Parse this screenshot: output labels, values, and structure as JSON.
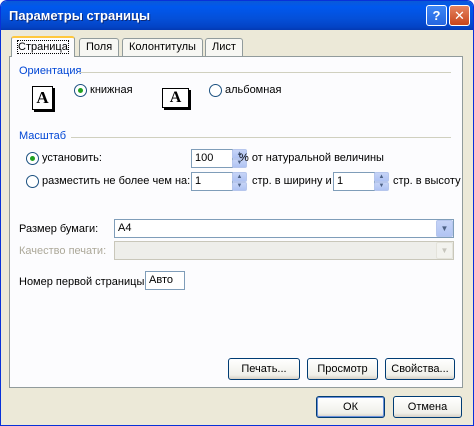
{
  "window": {
    "title": "Параметры страницы",
    "help_glyph": "?",
    "close_glyph": "✕"
  },
  "tabs": [
    {
      "label": "Страница",
      "active": true
    },
    {
      "label": "Поля"
    },
    {
      "label": "Колонтитулы"
    },
    {
      "label": "Лист"
    }
  ],
  "orientation": {
    "label": "Ориентация",
    "portrait_label": "книжная",
    "landscape_label": "альбомная",
    "icon_letter": "A",
    "selected": "portrait"
  },
  "scale": {
    "label": "Масштаб",
    "set_label": "установить:",
    "set_value": "100",
    "set_suffix": "% от натуральной величины",
    "fit_label": "разместить не более чем на:",
    "fit_width_value": "1",
    "fit_width_suffix": "стр. в ширину и",
    "fit_height_value": "1",
    "fit_height_suffix": "стр. в высоту",
    "selected": "set"
  },
  "paper": {
    "label": "Размер бумаги:",
    "value": "A4"
  },
  "quality": {
    "label": "Качество печати:",
    "value": ""
  },
  "first_page": {
    "label": "Номер первой страницы:",
    "value": "Авто"
  },
  "buttons": {
    "print": "Печать...",
    "preview": "Просмотр",
    "properties": "Свойства...",
    "ok": "ОК",
    "cancel": "Отмена"
  }
}
